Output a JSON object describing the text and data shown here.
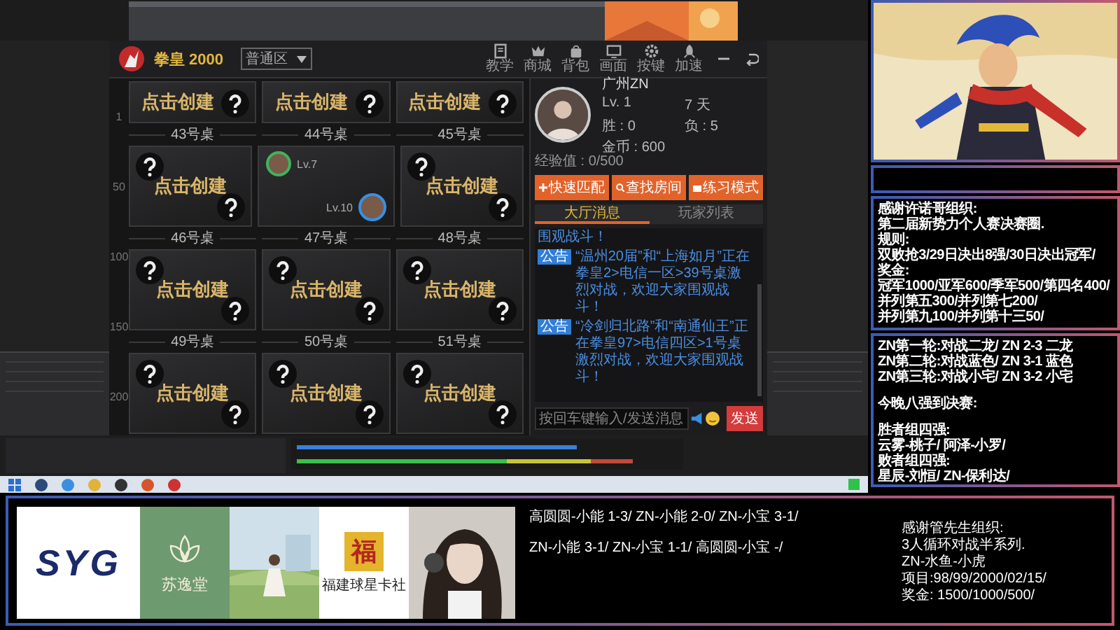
{
  "game": {
    "title": "拳皇 2000",
    "server": "普通区",
    "nav": [
      {
        "kind": "book",
        "label": "教学"
      },
      {
        "kind": "crown",
        "label": "商城"
      },
      {
        "kind": "bag",
        "label": "背包"
      },
      {
        "kind": "monitor",
        "label": "画面"
      },
      {
        "kind": "gear",
        "label": "按键"
      },
      {
        "kind": "rocket",
        "label": "加速"
      }
    ],
    "scale": [
      "1",
      "50",
      "100",
      "150",
      "200"
    ],
    "table_rows": [
      {
        "cards": [
          {
            "kind": "empty",
            "text": "点击创建"
          },
          {
            "kind": "empty",
            "text": "点击创建"
          },
          {
            "kind": "empty",
            "text": "点击创建"
          }
        ],
        "labels": [
          "43号桌",
          "44号桌",
          "45号桌"
        ]
      },
      {
        "cards": [
          {
            "kind": "empty",
            "text": "点击创建"
          },
          {
            "kind": "occupied",
            "players": [
              {
                "level": "Lv.7"
              },
              {
                "level": "Lv.10"
              }
            ]
          },
          {
            "kind": "empty",
            "text": "点击创建"
          }
        ],
        "labels": [
          "46号桌",
          "47号桌",
          "48号桌"
        ]
      },
      {
        "cards": [
          {
            "kind": "empty",
            "text": "点击创建"
          },
          {
            "kind": "empty",
            "text": "点击创建"
          },
          {
            "kind": "empty",
            "text": "点击创建"
          }
        ],
        "labels": [
          "49号桌",
          "50号桌",
          "51号桌"
        ]
      },
      {
        "cards": [
          {
            "kind": "empty",
            "text": "点击创建"
          },
          {
            "kind": "empty",
            "text": "点击创建"
          },
          {
            "kind": "empty",
            "text": "点击创建"
          }
        ]
      }
    ],
    "profile": {
      "name": "广州ZN",
      "level": "Lv. 1",
      "days": "7 天",
      "wins": "胜 : 0",
      "losses": "负 : 5",
      "coins": "金币 : 600",
      "experience": "经验值 : 0/500"
    },
    "actions": [
      {
        "kind": "plus",
        "label": "快速匹配"
      },
      {
        "kind": "search",
        "label": "查找房间"
      },
      {
        "kind": "practice",
        "label": "练习模式"
      }
    ],
    "tabs": [
      {
        "label": "大厅消息",
        "selected": true
      },
      {
        "label": "玩家列表",
        "selected": false
      }
    ],
    "messages": [
      {
        "kind": "tail",
        "text": "围观战斗！"
      },
      {
        "kind": "notice",
        "badge": "公告",
        "text": "“温州20届”和“上海如月”正在拳皇2>电信一区>39号桌激烈对战，欢迎大家围观战斗！"
      },
      {
        "kind": "notice",
        "badge": "公告",
        "text": "“冷剑归北路”和“南通仙王”正在拳皇97>电信四区>1号桌激烈对战，欢迎大家围观战斗！"
      }
    ],
    "chat": {
      "placeholder": "按回车键输入/发送消息",
      "send": "发送"
    }
  },
  "right_panels": [
    {
      "groups": [
        [
          "感谢许诺哥组织:",
          "第二届新势力个人赛决赛圈.",
          "规则:",
          "双败抢3/29日决出8强/30日决出冠军/",
          "奖金:",
          "冠军1000/亚军600/季军500/第四名400/",
          "并列第五300/并列第七200/",
          "并列第九100/并列第十三50/"
        ]
      ]
    },
    {
      "groups": [
        [
          "ZN第一轮:对战二龙/ ZN 2-3 二龙",
          "ZN第二轮:对战蓝色/ ZN 3-1 蓝色",
          "ZN第三轮:对战小宅/ ZN 3-2 小宅"
        ],
        [
          "今晚八强到决赛:"
        ],
        [
          "胜者组四强:",
          "云雾-桃子/ 阿泽-小罗/",
          "败者组四强:",
          "星辰-刘恒/ ZN-保利达/"
        ]
      ]
    }
  ],
  "bottom": {
    "logos": [
      {
        "kind": "syg",
        "text": "SYG"
      },
      {
        "kind": "lotus",
        "text": "苏逸堂"
      },
      {
        "kind": "picture"
      },
      {
        "kind": "fu",
        "text": "福",
        "subtitle": "福建球星卡社"
      },
      {
        "kind": "picture"
      }
    ],
    "results": [
      "高圆圆-小能 1-3/ ZN-小能 2-0/ ZN-小宝 3-1/",
      "ZN-小能 3-1/ ZN-小宝 1-1/ 高圆圆-小宝 -/"
    ],
    "notes": [
      "感谢管先生组织:",
      "3人循环对战半系列.",
      "ZN-水鱼-小虎",
      "项目:98/99/2000/02/15/",
      "奖金: 1500/1000/500/"
    ]
  }
}
